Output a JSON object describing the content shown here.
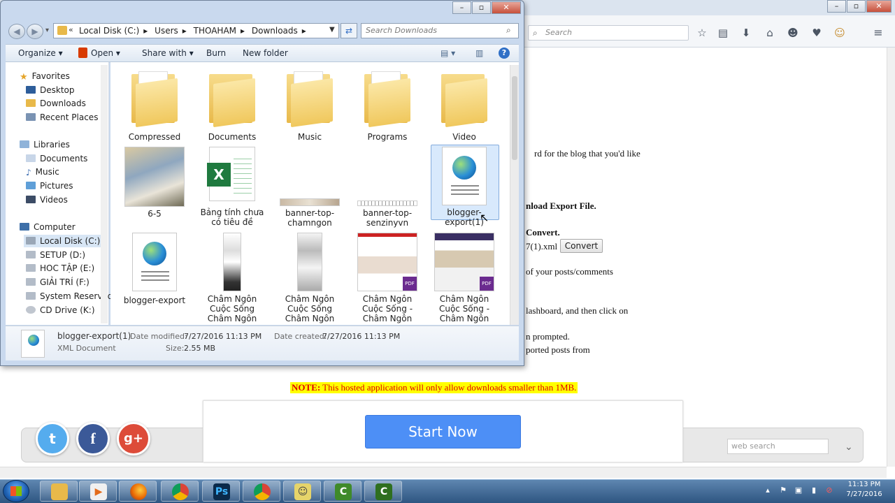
{
  "browser": {
    "search_placeholder": "Search",
    "toolbar_icons": [
      "star-icon",
      "clipboard-icon",
      "download-icon",
      "home-icon",
      "chat-icon",
      "pocket-icon",
      "emoji-icon",
      "menu-icon"
    ],
    "page_fragments": [
      "rd for the blog that you'd like",
      "nload Export File.",
      "Convert.",
      "7(1).xml",
      "of your posts/comments",
      "lashboard, and then click on",
      "n prompted.",
      "ported posts from"
    ],
    "convert_label": "Convert",
    "notice_label": "NOTE:",
    "notice_text": " This hosted application will only allow downloads smaller than 1MB.",
    "start_now": "Start Now",
    "web_search_placeholder": "web search"
  },
  "explorer": {
    "breadcrumb": [
      "Local Disk (C:)",
      "Users",
      "THOAHAM",
      "Downloads"
    ],
    "search_placeholder": "Search Downloads",
    "commands": {
      "organize": "Organize",
      "open": "Open",
      "share": "Share with",
      "burn": "Burn",
      "new_folder": "New folder"
    },
    "nav": {
      "favorites": "Favorites",
      "fav_items": [
        "Desktop",
        "Downloads",
        "Recent Places"
      ],
      "libraries": "Libraries",
      "lib_items": [
        "Documents",
        "Music",
        "Pictures",
        "Videos"
      ],
      "computer": "Computer",
      "drives": [
        "Local Disk (C:)",
        "SETUP (D:)",
        "HOC TẬP (E:)",
        "GIẢI TRÍ (F:)",
        "System Reserved",
        "CD Drive (K:)"
      ]
    },
    "files": {
      "row1": [
        "Compressed",
        "Documents",
        "Music",
        "Programs",
        "Video"
      ],
      "f6": "6-5",
      "f7": "Bảng tính chưa có tiêu đề",
      "f8": "banner-top-chamngon",
      "f9": "banner-top-senzinyvn",
      "f10": "blogger-export(1)",
      "f11": "blogger-export",
      "f12": "Châm Ngôn Cuộc Sống Châm Ngôn",
      "f13": "Châm Ngôn Cuộc Sống Châm Ngôn",
      "f14": "Châm Ngôn Cuộc Sống - Châm Ngôn",
      "f15": "Châm Ngôn Cuộc Sống - Châm Ngôn",
      "pdf": "PDF"
    },
    "details": {
      "name": "blogger-export(1)",
      "type": "XML Document",
      "modified_label": "Date modified:",
      "modified": "7/27/2016 11:13 PM",
      "size_label": "Size:",
      "size": "2.55 MB",
      "created_label": "Date created:",
      "created": "7/27/2016 11:13 PM"
    }
  },
  "taskbar": {
    "clock_time": "11:13 PM",
    "clock_date": "7/27/2016",
    "ps_label": "Ps",
    "cam_label": "C"
  },
  "colors": {
    "accent": "#4d8ff6",
    "notice_bg": "#ffff00",
    "notice_fg": "#e00000",
    "twitter": "#55acee",
    "facebook": "#3b5998",
    "gplus": "#dd4b39"
  }
}
